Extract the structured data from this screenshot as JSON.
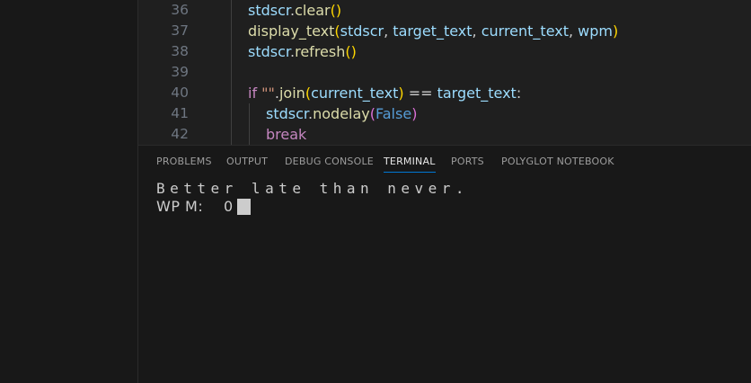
{
  "editor": {
    "lines": [
      {
        "num": "36",
        "tokens": [
          {
            "t": "stdscr",
            "c": "t-var"
          },
          {
            "t": ".",
            "c": "t-def"
          },
          {
            "t": "clear",
            "c": "t-fn"
          },
          {
            "t": "()",
            "c": "t-p1"
          }
        ]
      },
      {
        "num": "37",
        "tokens": [
          {
            "t": "display_text",
            "c": "t-fn"
          },
          {
            "t": "(",
            "c": "t-p1"
          },
          {
            "t": "stdscr",
            "c": "t-var"
          },
          {
            "t": ", ",
            "c": "t-def"
          },
          {
            "t": "target_text",
            "c": "t-var"
          },
          {
            "t": ", ",
            "c": "t-def"
          },
          {
            "t": "current_text",
            "c": "t-var"
          },
          {
            "t": ", ",
            "c": "t-def"
          },
          {
            "t": "wpm",
            "c": "t-var"
          },
          {
            "t": ")",
            "c": "t-p1"
          }
        ]
      },
      {
        "num": "38",
        "tokens": [
          {
            "t": "stdscr",
            "c": "t-var"
          },
          {
            "t": ".",
            "c": "t-def"
          },
          {
            "t": "refresh",
            "c": "t-fn"
          },
          {
            "t": "()",
            "c": "t-p1"
          }
        ]
      },
      {
        "num": "39",
        "tokens": []
      },
      {
        "num": "40",
        "tokens": [
          {
            "t": "if ",
            "c": "t-kw"
          },
          {
            "t": "\"\"",
            "c": "t-str"
          },
          {
            "t": ".",
            "c": "t-def"
          },
          {
            "t": "join",
            "c": "t-fn"
          },
          {
            "t": "(",
            "c": "t-p1"
          },
          {
            "t": "current_text",
            "c": "t-var"
          },
          {
            "t": ")",
            "c": "t-p1"
          },
          {
            "t": " == ",
            "c": "t-def"
          },
          {
            "t": "target_text",
            "c": "t-var"
          },
          {
            "t": ":",
            "c": "t-def"
          }
        ]
      },
      {
        "num": "41",
        "tokens": [
          {
            "t": "stdscr",
            "c": "t-var"
          },
          {
            "t": ".",
            "c": "t-def"
          },
          {
            "t": "nodelay",
            "c": "t-fn"
          },
          {
            "t": "(",
            "c": "t-p2"
          },
          {
            "t": "False",
            "c": "t-const"
          },
          {
            "t": ")",
            "c": "t-p2"
          }
        ]
      },
      {
        "num": "42",
        "tokens": [
          {
            "t": "break",
            "c": "t-kw"
          }
        ]
      }
    ]
  },
  "panel": {
    "tabs": [
      "PROBLEMS",
      "OUTPUT",
      "DEBUG CONSOLE",
      "TERMINAL",
      "PORTS",
      "POLYGLOT NOTEBOOK"
    ],
    "active_tab": "TERMINAL"
  },
  "terminal": {
    "line1": "Better late than never.",
    "wpm_label": "WP M:",
    "wpm_value": "0"
  },
  "colors": {
    "accent": "#0078d4",
    "background": "#1f1f1f",
    "panel_background": "#181818"
  }
}
